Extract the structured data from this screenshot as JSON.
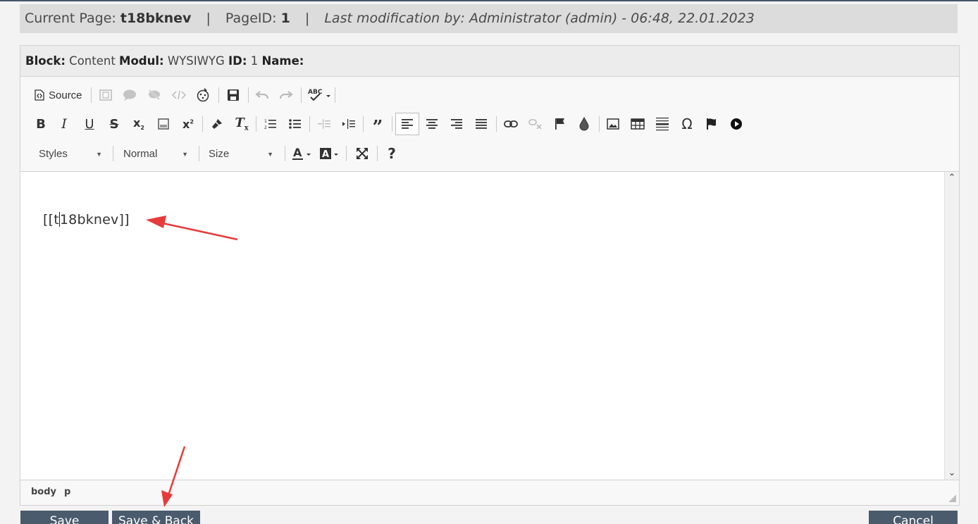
{
  "header": {
    "current_page_label": "Current Page:",
    "current_page_value": "t18bknev",
    "sep1": "|",
    "page_id_label": "PageID:",
    "page_id_value": "1",
    "sep2": "|",
    "last_mod": "Last modification by: Administrator (admin) - 06:48, 22.01.2023"
  },
  "block": {
    "block_label": "Block:",
    "block_value": "Content",
    "modul_label": "Modul:",
    "modul_value": "WYSIWYG",
    "id_label": "ID:",
    "id_value": "1",
    "name_label": "Name:",
    "name_value": ""
  },
  "toolbar": {
    "source_label": "Source",
    "styles_label": "Styles",
    "format_label": "Normal",
    "size_label": "Size"
  },
  "editor": {
    "content_before_caret": "[[t",
    "content_after_caret": "18bknev]]"
  },
  "pathbar": {
    "items": [
      "body",
      "p"
    ]
  },
  "buttons": {
    "save": "Save",
    "save_back": "Save & Back",
    "cancel": "Cancel"
  },
  "colors": {
    "button_bg": "#4b5b6e",
    "annotation_arrow": "#e83a3a"
  }
}
